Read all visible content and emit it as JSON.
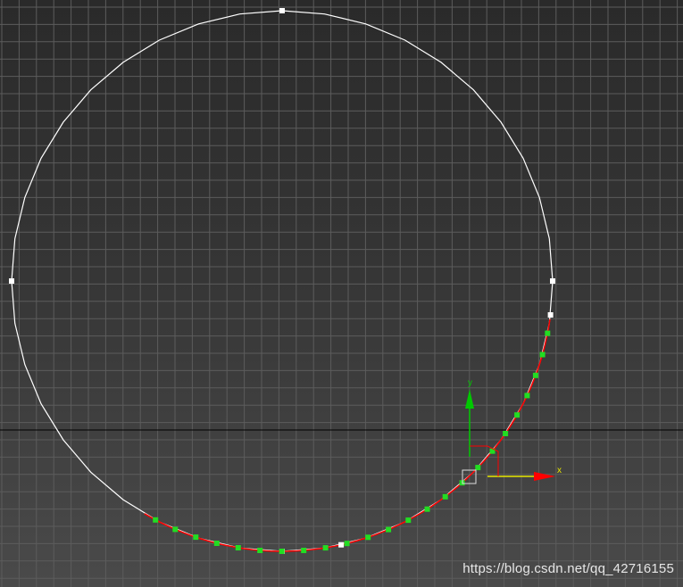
{
  "viewport": {
    "background_top": "#2a2a2a",
    "background_bottom": "#4a4a4a",
    "grid_color": "#5c5c5c",
    "home_grid_axis_color": "#000000"
  },
  "spline": {
    "color": "#ffffff",
    "selected_segment_color": "#ff0000",
    "vertex_color": "#ffffff",
    "selected_vertex_color": "#22dd22"
  },
  "gizmo": {
    "x_label": "x",
    "y_label": "y",
    "x_color": "#ff0000",
    "y_color": "#00c800",
    "x_shaft_color": "#e8e800",
    "plane_color": "#ff0000"
  },
  "watermark": "https://blog.csdn.net/qq_42716155"
}
